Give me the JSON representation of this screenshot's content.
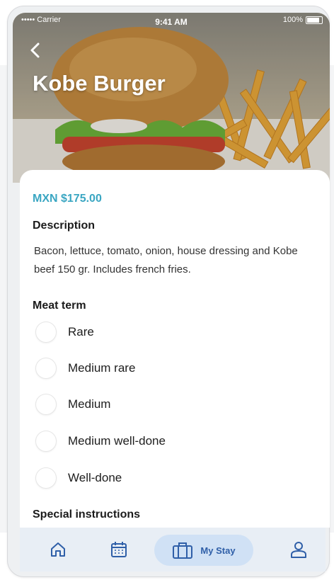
{
  "status_bar": {
    "carrier": "••••• Carrier",
    "time": "9:41 AM",
    "battery": "100%"
  },
  "header": {
    "back_icon": "chevron-left-icon",
    "title": "Kobe Burger"
  },
  "item": {
    "price": "MXN $175.00",
    "description_label": "Description",
    "description": "Bacon, lettuce, tomato, onion, house dressing and Kobe beef 150 gr. Includes french fries."
  },
  "meat_term": {
    "label": "Meat term",
    "options": [
      "Rare",
      "Medium rare",
      "Medium",
      "Medium well-done",
      "Well-done"
    ]
  },
  "special_instructions": {
    "label": "Special instructions"
  },
  "nav": {
    "items": [
      {
        "icon": "home-icon"
      },
      {
        "icon": "calendar-icon"
      },
      {
        "icon": "suitcase-icon",
        "label": "My Stay",
        "active": true
      },
      {
        "icon": "user-icon"
      }
    ]
  },
  "colors": {
    "accent": "#3aa6c2",
    "nav_active": "#2f5fa8",
    "nav_bg": "#e8eef5"
  }
}
